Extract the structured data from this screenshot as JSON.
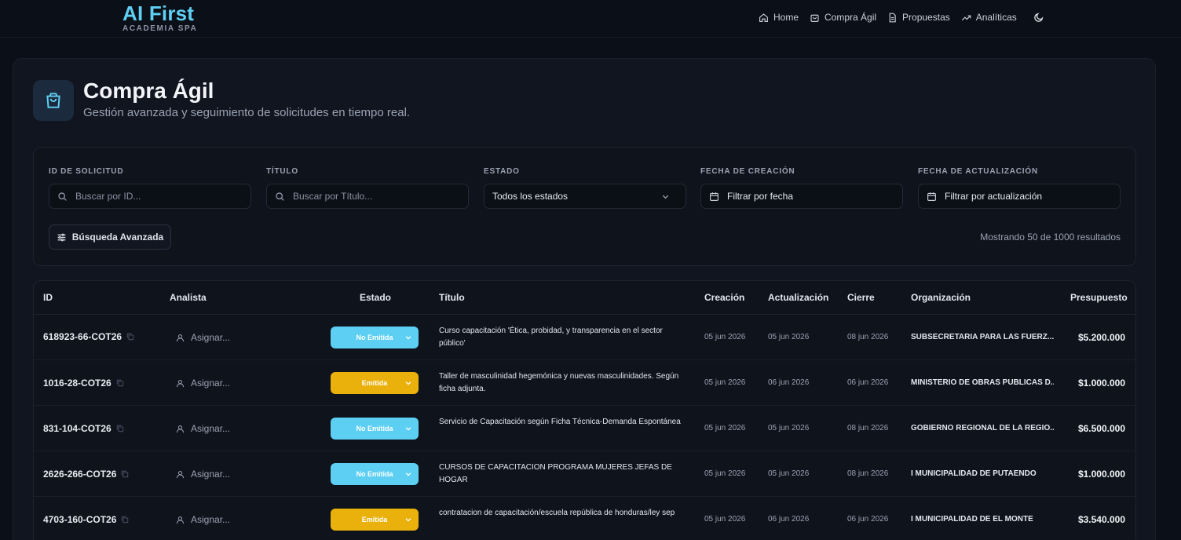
{
  "brand": {
    "title": "AI First",
    "subtitle": "ACADEMIA SPA"
  },
  "nav": {
    "items": [
      {
        "label": "Home",
        "icon": "home-icon"
      },
      {
        "label": "Compra Ágil",
        "icon": "shopping-bag-icon"
      },
      {
        "label": "Propuestas",
        "icon": "document-icon"
      },
      {
        "label": "Analíticas",
        "icon": "trending-up-icon"
      }
    ],
    "theme_icon": "moon-icon"
  },
  "header": {
    "title": "Compra Ágil",
    "subtitle": "Gestión avanzada y seguimiento de solicitudes en tiempo real.",
    "icon": "shopping-bag-icon"
  },
  "filters": {
    "id": {
      "label": "ID DE SOLICITUD",
      "placeholder": "Buscar por ID..."
    },
    "title": {
      "label": "TÍTULO",
      "placeholder": "Buscar por Título..."
    },
    "status": {
      "label": "ESTADO",
      "value": "Todos los estados"
    },
    "created": {
      "label": "FECHA DE CREACIÓN",
      "placeholder": "Filtrar por fecha"
    },
    "updated": {
      "label": "FECHA DE ACTUALIZACIÓN",
      "placeholder": "Filtrar por actualización"
    },
    "advanced_label": "Búsqueda Avanzada",
    "results_text": "Mostrando 50 de 1000 resultados"
  },
  "table": {
    "columns": {
      "id": "ID",
      "analyst": "Analista",
      "status": "Estado",
      "title": "Título",
      "created": "Creación",
      "updated": "Actualización",
      "close": "Cierre",
      "org": "Organización",
      "budget": "Presupuesto"
    },
    "rows": [
      {
        "id": "618923-66-COT26",
        "analyst": "Asignar...",
        "status": "No Emitida",
        "title": "Curso capacitación 'Ética, probidad, y transparencia en el sector público'",
        "created": "05 jun 2026",
        "updated": "05 jun 2026",
        "close": "08 jun 2026",
        "org": "SUBSECRETARIA PARA LAS FUERZ...",
        "budget": "$5.200.000"
      },
      {
        "id": "1016-28-COT26",
        "analyst": "Asignar...",
        "status": "Emitida",
        "title": "Taller de masculinidad hegemónica y nuevas masculinidades. Según ficha adjunta.",
        "created": "05 jun 2026",
        "updated": "06 jun 2026",
        "close": "06 jun 2026",
        "org": "MINISTERIO DE OBRAS PUBLICAS D...",
        "budget": "$1.000.000"
      },
      {
        "id": "831-104-COT26",
        "analyst": "Asignar...",
        "status": "No Emitida",
        "title": "Servicio de Capacitación según Ficha Técnica-Demanda Espontánea",
        "created": "05 jun 2026",
        "updated": "05 jun 2026",
        "close": "08 jun 2026",
        "org": "GOBIERNO REGIONAL DE LA REGIO...",
        "budget": "$6.500.000"
      },
      {
        "id": "2626-266-COT26",
        "analyst": "Asignar...",
        "status": "No Emitida",
        "title": "CURSOS DE CAPACITACION PROGRAMA MUJERES JEFAS DE HOGAR",
        "created": "05 jun 2026",
        "updated": "05 jun 2026",
        "close": "08 jun 2026",
        "org": "I MUNICIPALIDAD DE PUTAENDO",
        "budget": "$1.000.000"
      },
      {
        "id": "4703-160-COT26",
        "analyst": "Asignar...",
        "status": "Emitida",
        "title": "contratacion de capacitación/escuela república de honduras/ley sep",
        "created": "05 jun 2026",
        "updated": "06 jun 2026",
        "close": "06 jun 2026",
        "org": "I MUNICIPALIDAD DE EL MONTE",
        "budget": "$3.540.000"
      }
    ]
  },
  "colors": {
    "brand": "#5fd0f3",
    "status_no_emitida": "#5ccff3",
    "status_emitida": "#eab00c",
    "background": "#0b0f17"
  }
}
